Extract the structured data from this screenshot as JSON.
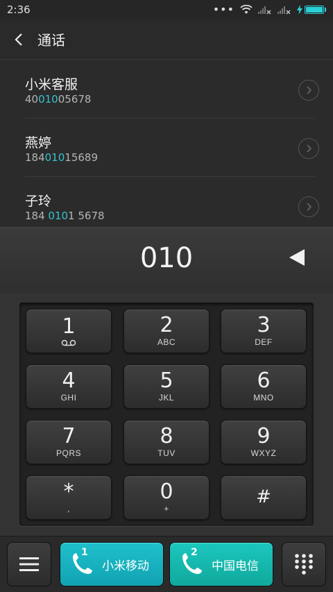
{
  "status": {
    "time": "2:36"
  },
  "header": {
    "title": "通话"
  },
  "contacts": [
    {
      "name": "小米客服",
      "pre": "40",
      "match": "010",
      "post": "05678"
    },
    {
      "name": "燕婷",
      "pre": "184",
      "match": "010",
      "post": "15689"
    },
    {
      "name": "子玲",
      "pre": "184 ",
      "match": "010",
      "post": "1 5678"
    }
  ],
  "dialer": {
    "number": "010"
  },
  "keys": [
    {
      "digit": "1",
      "letters": ""
    },
    {
      "digit": "2",
      "letters": "ABC"
    },
    {
      "digit": "3",
      "letters": "DEF"
    },
    {
      "digit": "4",
      "letters": "GHI"
    },
    {
      "digit": "5",
      "letters": "JKL"
    },
    {
      "digit": "6",
      "letters": "MNO"
    },
    {
      "digit": "7",
      "letters": "PQRS"
    },
    {
      "digit": "8",
      "letters": "TUV"
    },
    {
      "digit": "9",
      "letters": "WXYZ"
    },
    {
      "digit": "*",
      "letters": ","
    },
    {
      "digit": "0",
      "letters": "+"
    },
    {
      "digit": "#",
      "letters": ""
    }
  ],
  "bottom": {
    "sim1": {
      "index": "1",
      "label": "小米移动"
    },
    "sim2": {
      "index": "2",
      "label": "中国电信"
    }
  },
  "icons": {
    "back": "chevron-left-icon",
    "chevron": "chevron-right-icon",
    "backspace": "backspace-icon",
    "menu": "menu-icon",
    "dialpad": "dialpad-icon",
    "voicemail": "voicemail-icon",
    "phone": "phone-icon"
  },
  "colors": {
    "accent": "#35c4cf",
    "sim1": "#1fc0cc",
    "sim2": "#1bc7bd"
  }
}
